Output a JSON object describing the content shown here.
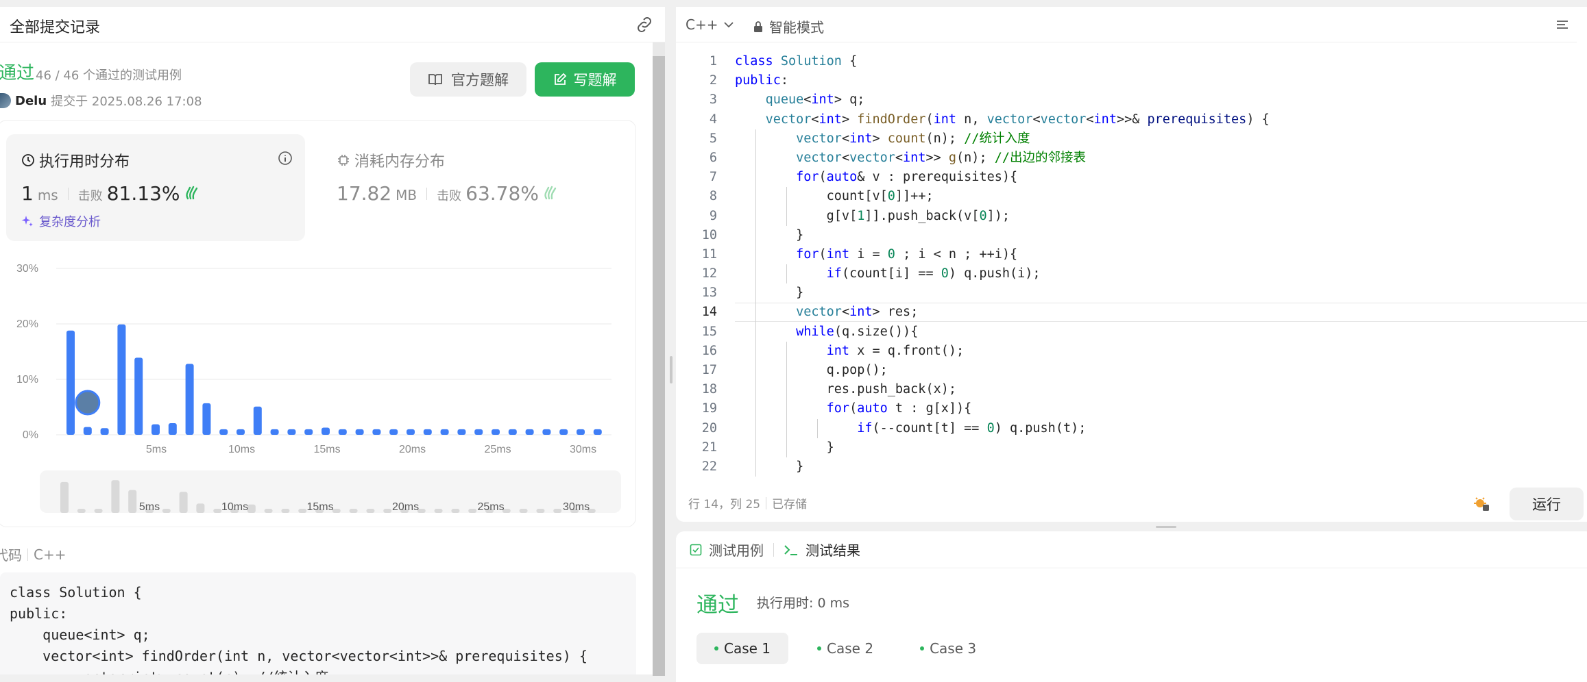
{
  "left": {
    "title": "全部提交记录",
    "status": "通过",
    "pass_count": "46 / 46 个通过的测试用例",
    "author": "Delu",
    "submitted_at": "提交于 2025.08.26 17:08",
    "btn_official": "官方题解",
    "btn_write": "写题解",
    "runtime": {
      "title": "执行用时分布",
      "value": "1",
      "unit": "ms",
      "beat_label": "击败",
      "beat_value": "81.13%",
      "complexity": "复杂度分析"
    },
    "memory": {
      "title": "消耗内存分布",
      "value": "17.82",
      "unit": "MB",
      "beat_label": "击败",
      "beat_value": "63.78%"
    },
    "code_tabs": [
      "代码",
      "C++"
    ],
    "code_preview": [
      "class Solution {",
      "public:",
      "    queue<int> q;",
      "    vector<int> findOrder(int n, vector<vector<int>>& prerequisites) {",
      "        vector<int> count(n); //统计入度"
    ]
  },
  "chart_data": {
    "type": "bar",
    "ylabel": "",
    "xlabel": "",
    "y_ticks": [
      "30%",
      "20%",
      "10%",
      "0%"
    ],
    "x_ticks": [
      "5ms",
      "10ms",
      "15ms",
      "20ms",
      "25ms",
      "30ms"
    ],
    "ylim": [
      0,
      30
    ],
    "x": [
      1,
      2,
      3,
      4,
      5,
      6,
      7,
      8,
      9,
      10,
      11,
      12,
      13,
      14,
      15,
      16,
      17,
      18,
      19,
      20,
      21,
      22,
      23,
      24,
      25,
      26,
      27,
      28,
      29,
      30,
      31,
      32
    ],
    "values": [
      18.8,
      1.4,
      1.2,
      19.9,
      13.9,
      1.9,
      2.1,
      12.8,
      5.7,
      1.0,
      1.0,
      5.1,
      1.0,
      1.0,
      1.0,
      1.3,
      1.0,
      1.0,
      1.0,
      1.0,
      1.0,
      1.0,
      1.0,
      1.0,
      1.0,
      1.0,
      1.0,
      1.0,
      1.0,
      1.0,
      1.0,
      1.0
    ],
    "highlight_x": 2,
    "grid": true,
    "bar_color": "#3f7ef6"
  },
  "editor": {
    "language": "C++",
    "mode": "智能模式",
    "cursor": "行 14，列 25",
    "saved": "已存储",
    "run": "运行",
    "current_line": 14
  },
  "result": {
    "tab_cases": "测试用例",
    "tab_result": "测试结果",
    "status": "通过",
    "time": "执行用时: 0 ms",
    "cases": [
      "Case 1",
      "Case 2",
      "Case 3"
    ]
  },
  "colors": {
    "accent": "#2db55d",
    "bar": "#3f7ef6",
    "keyword": "#0000ff",
    "type": "#267f99",
    "comment": "#008000",
    "number": "#098658"
  }
}
